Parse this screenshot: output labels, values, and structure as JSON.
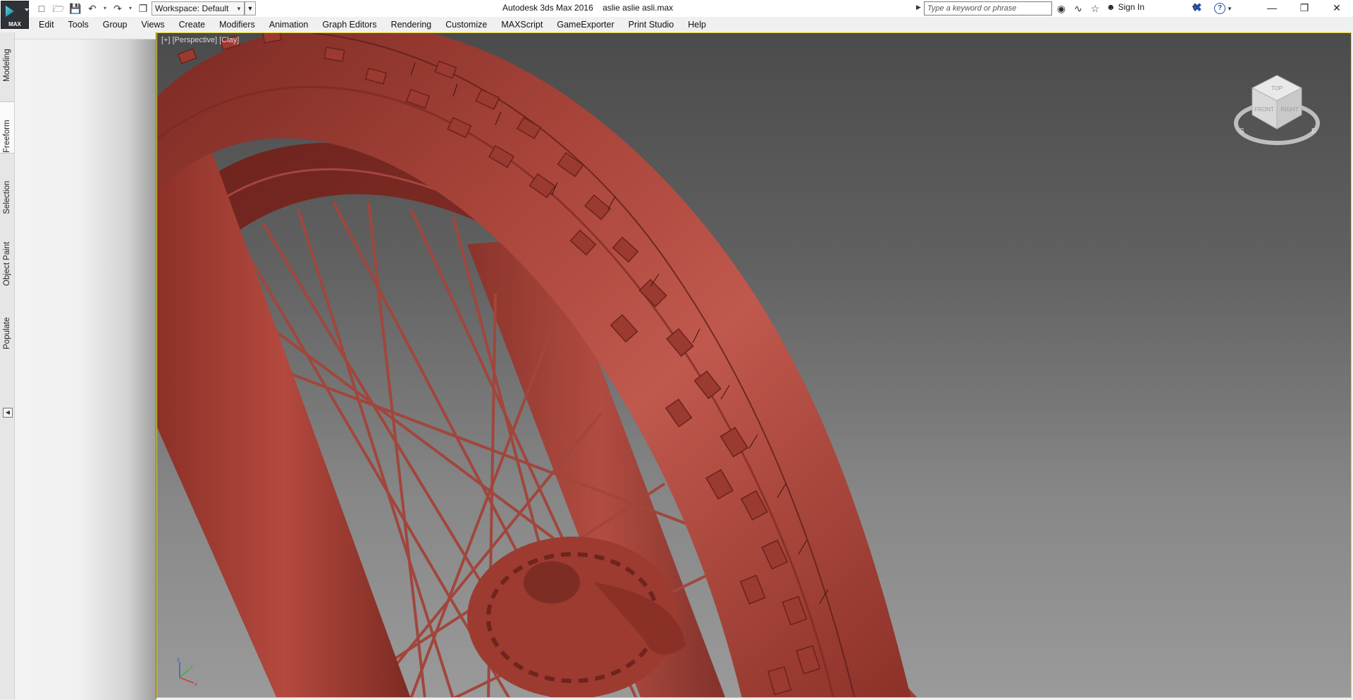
{
  "app": {
    "button_label": "MAX",
    "window_title": "Autodesk 3ds Max 2016",
    "file_name": "aslie aslie asli.max"
  },
  "quick_access": {
    "icons": [
      "new-file-icon",
      "open-file-icon",
      "save-file-icon",
      "undo-icon",
      "redo-icon",
      "project-folder-icon"
    ]
  },
  "workspace": {
    "label": "Workspace: Default"
  },
  "infocenter": {
    "search_placeholder": "Type a keyword or phrase",
    "sign_in_label": "Sign In"
  },
  "menu": {
    "items": [
      "Edit",
      "Tools",
      "Group",
      "Views",
      "Create",
      "Modifiers",
      "Animation",
      "Graph Editors",
      "Rendering",
      "Customize",
      "MAXScript",
      "GameExporter",
      "Print Studio",
      "Help"
    ]
  },
  "ribbon_tabs": [
    "Modeling",
    "Freeform",
    "Selection",
    "Object Paint",
    "Populate"
  ],
  "ribbon_active_tab": "Freeform",
  "viewport": {
    "label": "[+] [Perspective] [Clay]",
    "border_color": "#e6d21a",
    "model_color": "#b3463b",
    "viewcube_faces": [
      "TOP",
      "FRONT",
      "RIGHT"
    ],
    "compass": [
      "S",
      "E"
    ],
    "axes": [
      "x",
      "y",
      "z"
    ]
  }
}
